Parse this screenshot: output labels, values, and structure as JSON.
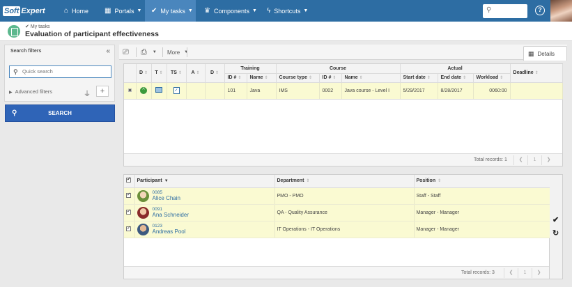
{
  "brand": {
    "soft": "Soft",
    "expert": "Expert"
  },
  "nav": [
    {
      "label": "Home",
      "icon": "home-icon"
    },
    {
      "label": "Portals",
      "icon": "grid-icon"
    },
    {
      "label": "My tasks",
      "icon": "check-icon",
      "active": true
    },
    {
      "label": "Components",
      "icon": "trophy-icon"
    },
    {
      "label": "Shortcuts",
      "icon": "bolt-icon"
    }
  ],
  "header": {
    "breadcrumb": "My tasks",
    "title": "Evaluation of participant effectiveness"
  },
  "filters": {
    "heading": "Search filters",
    "quick_search_placeholder": "Quick search",
    "advanced_label": "Advanced filters",
    "search_button": "SEARCH"
  },
  "toolbar": {
    "more_label": "More",
    "details_tab": "Details"
  },
  "grid1": {
    "group_training": "Training",
    "group_course": "Course",
    "group_actual": "Actual",
    "headers": {
      "d1": "D",
      "t": "T",
      "ts": "TS",
      "a": "A",
      "d2": "D",
      "training_id": "ID #",
      "training_name": "Name",
      "course_type": "Course type",
      "course_id": "ID #",
      "course_name": "Name",
      "start_date": "Start date",
      "end_date": "End date",
      "workload": "Workload",
      "deadline": "Deadline"
    },
    "row": {
      "training_id": "101",
      "training_name": "Java",
      "course_type": "IMS",
      "course_id": "0002",
      "course_name": "Java course - Level I",
      "start_date": "5/29/2017",
      "end_date": "8/28/2017",
      "workload": "0060:00",
      "deadline": ""
    },
    "total_records": "Total records: 1",
    "page": "1"
  },
  "grid2": {
    "headers": {
      "participant": "Participant",
      "department": "Department",
      "position": "Position"
    },
    "rows": [
      {
        "id": "0085",
        "name": "Alice Chain",
        "department": "PMO - PMO",
        "position": "Staff - Staff"
      },
      {
        "id": "0091",
        "name": "Ana Schneider",
        "department": "QA - Quality Assurance",
        "position": "Manager - Manager"
      },
      {
        "id": "0123",
        "name": "Andreas Pool",
        "department": "IT Operations - IT Operations",
        "position": "Manager - Manager"
      }
    ],
    "total_records": "Total records: 3",
    "page": "1"
  },
  "colors": {
    "nav_bg": "#2d6da3",
    "nav_active": "#4a86bd",
    "search_button": "#2f64b7",
    "row_highlight": "#fafad2",
    "link": "#2d6da3"
  }
}
